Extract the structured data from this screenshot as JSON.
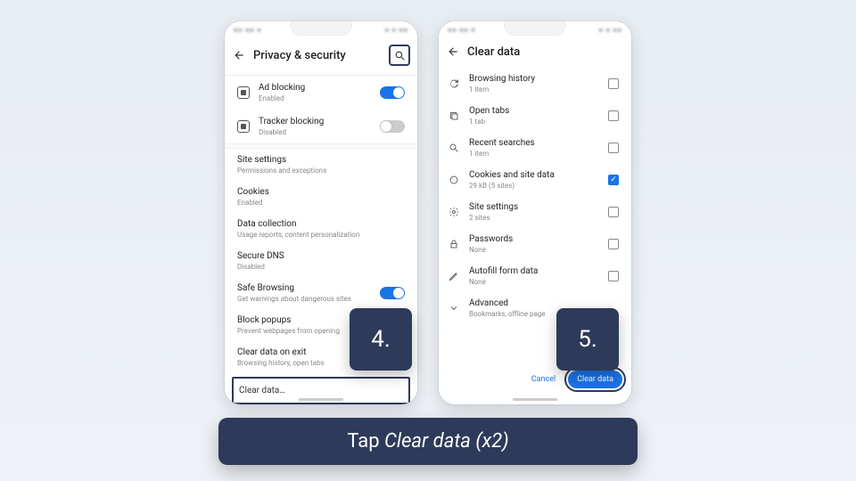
{
  "left": {
    "header_title": "Privacy & security",
    "ad_blocking": {
      "title": "Ad blocking",
      "sub": "Enabled",
      "on": true
    },
    "tracker_blocking": {
      "title": "Tracker blocking",
      "sub": "Disabled",
      "on": false
    },
    "site_settings": {
      "title": "Site settings",
      "sub": "Permissions and exceptions"
    },
    "cookies": {
      "title": "Cookies",
      "sub": "Enabled"
    },
    "data_collection": {
      "title": "Data collection",
      "sub": "Usage reports, content personalization"
    },
    "secure_dns": {
      "title": "Secure DNS",
      "sub": "Disabled"
    },
    "safe_browsing": {
      "title": "Safe Browsing",
      "sub": "Get warnings about dangerous sites",
      "on": true
    },
    "block_popups": {
      "title": "Block popups",
      "sub": "Prevent webpages from opening"
    },
    "clear_on_exit": {
      "title": "Clear data on exit",
      "sub": "Browsing history, open tabs"
    },
    "clear_data": "Clear data…"
  },
  "right": {
    "header_title": "Clear data",
    "rows": {
      "history": {
        "title": "Browsing history",
        "sub": "1 item",
        "checked": false
      },
      "tabs": {
        "title": "Open tabs",
        "sub": "1 tab",
        "checked": false
      },
      "searches": {
        "title": "Recent searches",
        "sub": "1 item",
        "checked": false
      },
      "cookies": {
        "title": "Cookies and site data",
        "sub": "29 kB (5 sites)",
        "checked": true
      },
      "site": {
        "title": "Site settings",
        "sub": "2 sites",
        "checked": false
      },
      "passwords": {
        "title": "Passwords",
        "sub": "None",
        "checked": false
      },
      "autofill": {
        "title": "Autofill form data",
        "sub": "None",
        "checked": false
      },
      "advanced": {
        "title": "Advanced",
        "sub": "Bookmarks, offline page"
      }
    },
    "cancel": "Cancel",
    "confirm": "Clear data"
  },
  "steps": {
    "four": "4.",
    "five": "5."
  },
  "caption_prefix": "Tap ",
  "caption_italic": "Clear data (x2)"
}
